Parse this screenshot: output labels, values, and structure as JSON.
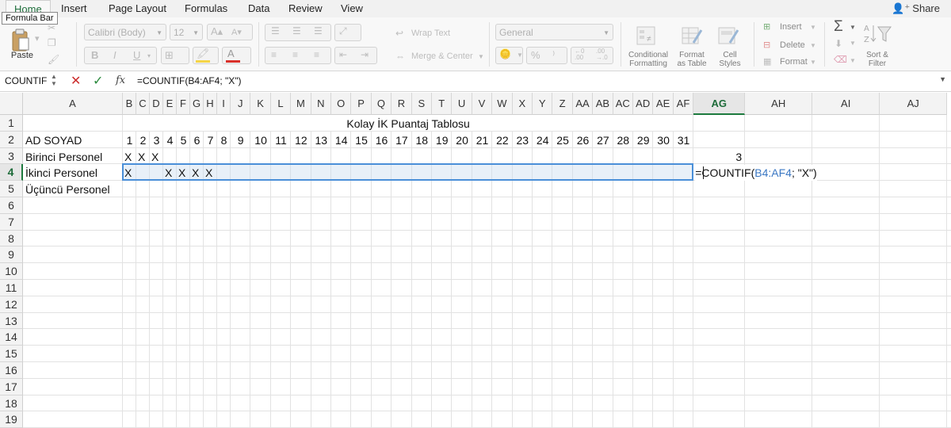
{
  "tabs": [
    {
      "id": "home",
      "label": "Home",
      "active": true
    },
    {
      "id": "insert",
      "label": "Insert"
    },
    {
      "id": "page-layout",
      "label": "Page Layout"
    },
    {
      "id": "formulas",
      "label": "Formulas"
    },
    {
      "id": "data",
      "label": "Data"
    },
    {
      "id": "review",
      "label": "Review"
    },
    {
      "id": "view",
      "label": "View"
    }
  ],
  "tooltip": "Formula Bar",
  "share_label": "Share",
  "ribbon": {
    "paste_label": "Paste",
    "font_name": "Calibri (Body)",
    "font_size": "12",
    "wrap_text": "Wrap Text",
    "merge_center": "Merge & Center",
    "number_format": "General",
    "conditional_formatting": [
      "Conditional",
      "Formatting"
    ],
    "format_as_table": [
      "Format",
      "as Table"
    ],
    "cell_styles": [
      "Cell",
      "Styles"
    ],
    "insert": "Insert",
    "delete": "Delete",
    "format": "Format",
    "sort_filter": [
      "Sort &",
      "Filter"
    ]
  },
  "formula_bar": {
    "name_box": "COUNTIF",
    "formula": "=COUNTIF(B4:AF4; \"X\")"
  },
  "columns": [
    "A",
    "B",
    "C",
    "D",
    "E",
    "F",
    "G",
    "H",
    "I",
    "J",
    "K",
    "L",
    "M",
    "N",
    "O",
    "P",
    "Q",
    "R",
    "S",
    "T",
    "U",
    "V",
    "W",
    "X",
    "Y",
    "Z",
    "AA",
    "AB",
    "AC",
    "AD",
    "AE",
    "AF",
    "AG",
    "AH",
    "AI",
    "AJ"
  ],
  "selected_column": "AG",
  "rows": [
    "1",
    "2",
    "3",
    "4",
    "5",
    "6",
    "7",
    "8",
    "9",
    "10",
    "11",
    "12",
    "13",
    "14",
    "15",
    "16",
    "17",
    "18",
    "19"
  ],
  "selected_row": "4",
  "sheet": {
    "title": "Kolay İK Puantaj Tablosu",
    "header_label": "AD SOYAD",
    "days": [
      "1",
      "2",
      "3",
      "4",
      "5",
      "6",
      "7",
      "8",
      "9",
      "10",
      "11",
      "12",
      "13",
      "14",
      "15",
      "16",
      "17",
      "18",
      "19",
      "20",
      "21",
      "22",
      "23",
      "24",
      "25",
      "26",
      "27",
      "28",
      "29",
      "30",
      "31"
    ],
    "employees": [
      "Birinci Personel",
      "İkinci Personel",
      "Üçüncü Personel"
    ],
    "marks": [
      {
        "row": "3",
        "col": "B",
        "value": "X"
      },
      {
        "row": "3",
        "col": "C",
        "value": "X"
      },
      {
        "row": "3",
        "col": "D",
        "value": "X"
      },
      {
        "row": "4",
        "col": "B",
        "value": "X"
      },
      {
        "row": "4",
        "col": "E",
        "value": "X"
      },
      {
        "row": "4",
        "col": "F",
        "value": "X"
      },
      {
        "row": "4",
        "col": "G",
        "value": "X"
      },
      {
        "row": "4",
        "col": "H",
        "value": "X"
      }
    ],
    "ag3_value": "3",
    "ag4_formula": {
      "prefix": "=COUNTIF(",
      "ref": "B4:AF4",
      "suffix": "; \"X\")"
    }
  },
  "colors": {
    "accent": "#1e7145",
    "selection": "#4a8fd8",
    "ref": "#3b78c4"
  }
}
